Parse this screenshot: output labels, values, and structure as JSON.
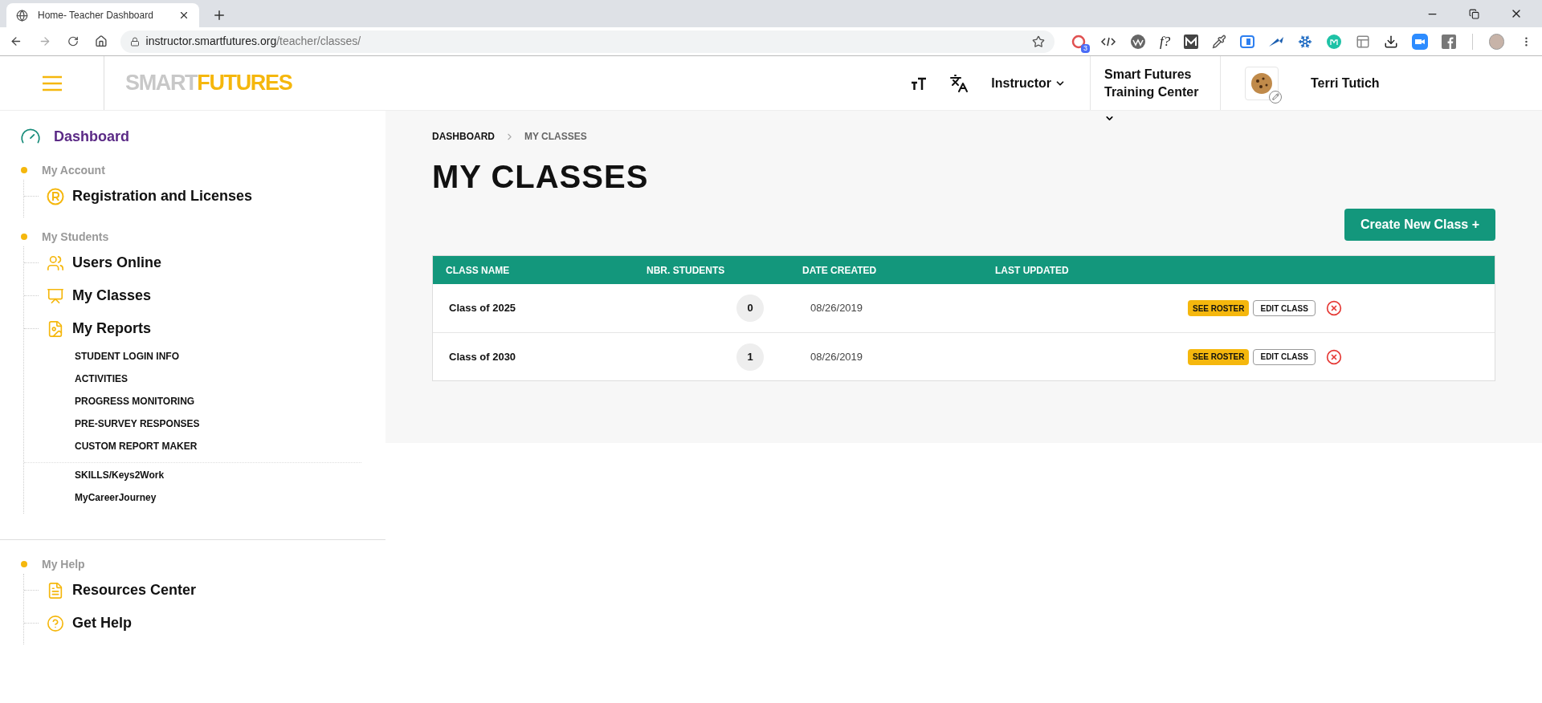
{
  "browser": {
    "tab_title": "Home- Teacher Dashboard",
    "url_host": "instructor.smartfutures.org",
    "url_path": "/teacher/classes/",
    "extensions": [
      {
        "kind": "badge",
        "badge": "3"
      },
      {
        "kind": "code"
      },
      {
        "kind": "wave"
      },
      {
        "kind": "text",
        "label": "f?"
      },
      {
        "kind": "m"
      },
      {
        "kind": "dropper"
      },
      {
        "kind": "blue"
      },
      {
        "kind": "arrow"
      },
      {
        "kind": "flake"
      },
      {
        "kind": "circle"
      },
      {
        "kind": "layout"
      },
      {
        "kind": "download"
      },
      {
        "kind": "camera"
      },
      {
        "kind": "facebook"
      }
    ]
  },
  "header": {
    "logo_part1": "SMART",
    "logo_part2": "FUTURES",
    "role": "Instructor",
    "center_line1": "Smart Futures",
    "center_line2": "Training Center",
    "user": "Terri Tutich"
  },
  "sidebar": {
    "dashboard": "Dashboard",
    "sections": [
      {
        "title": "My Account",
        "items": [
          {
            "kind": "registered",
            "label": "Registration and Licenses"
          }
        ]
      },
      {
        "title": "My Students",
        "items": [
          {
            "kind": "users",
            "label": "Users Online"
          },
          {
            "kind": "board",
            "label": "My Classes"
          },
          {
            "kind": "report",
            "label": "My Reports",
            "children": [
              {
                "label": "STUDENT LOGIN INFO"
              },
              {
                "label": "ACTIVITIES"
              },
              {
                "label": "PROGRESS MONITORING"
              },
              {
                "label": "PRE-SURVEY RESPONSES"
              },
              {
                "label": "CUSTOM REPORT MAKER"
              }
            ],
            "extra": [
              {
                "label": "SKILLS/Keys2Work"
              },
              {
                "label": "MyCareerJourney"
              }
            ]
          }
        ]
      },
      {
        "title": "My Help",
        "items": [
          {
            "kind": "document",
            "label": "Resources Center"
          },
          {
            "kind": "help",
            "label": "Get Help"
          }
        ]
      }
    ]
  },
  "breadcrumb": [
    {
      "label": "DASHBOARD",
      "selected": false
    },
    {
      "label": "MY CLASSES",
      "selected": true
    }
  ],
  "page_title": "MY CLASSES",
  "create_button": "Create New Class +",
  "table": {
    "columns": [
      "CLASS NAME",
      "NBR. STUDENTS",
      "DATE CREATED",
      "LAST UPDATED"
    ],
    "rows": [
      {
        "name": "Class of 2025",
        "students": "0",
        "created": "08/26/2019",
        "roster": "SEE ROSTER",
        "edit": "EDIT CLASS"
      },
      {
        "name": "Class of 2030",
        "students": "1",
        "created": "08/26/2019",
        "roster": "SEE ROSTER",
        "edit": "EDIT CLASS"
      }
    ]
  }
}
